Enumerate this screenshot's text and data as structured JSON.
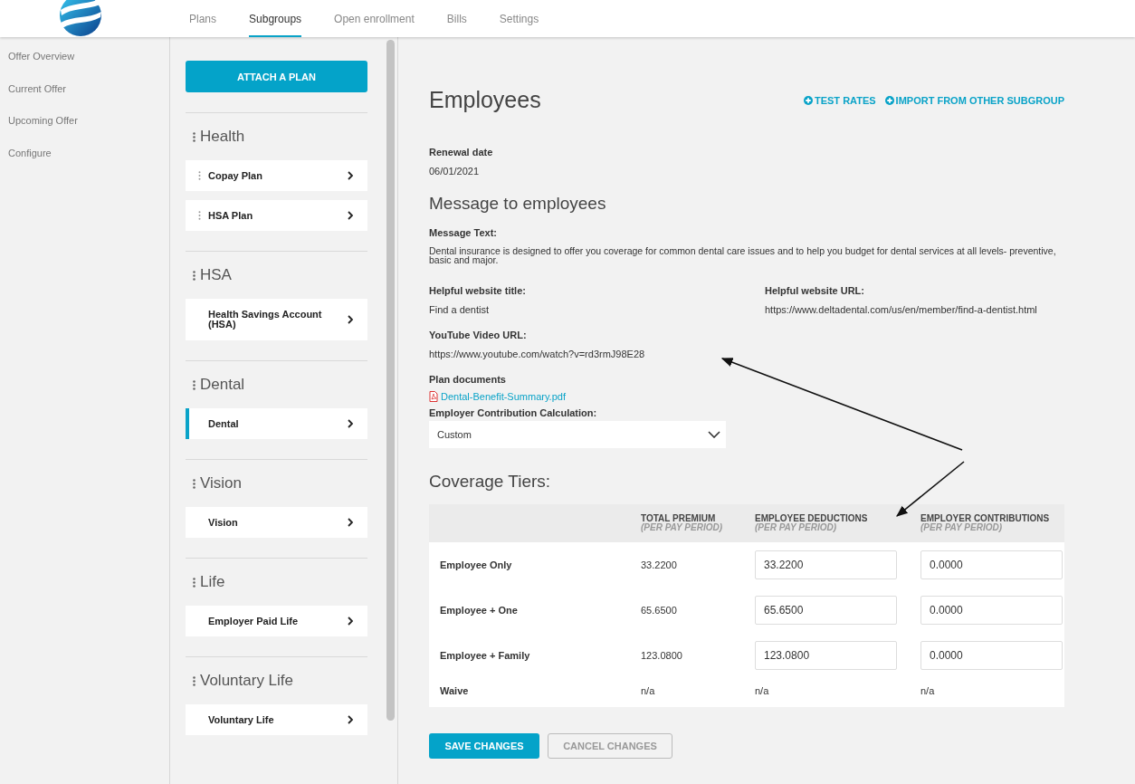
{
  "nav": {
    "tabs": [
      {
        "label": "Plans",
        "selected": false
      },
      {
        "label": "Subgroups",
        "selected": true
      },
      {
        "label": "Open enrollment",
        "selected": false
      },
      {
        "label": "Bills",
        "selected": false
      },
      {
        "label": "Settings",
        "selected": false
      }
    ]
  },
  "sidebar": {
    "items": [
      "Offer Overview",
      "Current Offer",
      "Upcoming Offer",
      "Configure"
    ]
  },
  "plan_panel": {
    "attach_button": "ATTACH A PLAN",
    "groups": [
      {
        "title": "Health",
        "items": [
          {
            "label": "Copay Plan",
            "selected": false,
            "draggable": true
          },
          {
            "label": "HSA Plan",
            "selected": false,
            "draggable": true
          }
        ]
      },
      {
        "title": "HSA",
        "items": [
          {
            "label": "Health Savings Account (HSA)",
            "selected": false,
            "draggable": false
          }
        ]
      },
      {
        "title": "Dental",
        "items": [
          {
            "label": "Dental",
            "selected": true,
            "draggable": false
          }
        ]
      },
      {
        "title": "Vision",
        "items": [
          {
            "label": "Vision",
            "selected": false,
            "draggable": false
          }
        ]
      },
      {
        "title": "Life",
        "items": [
          {
            "label": "Employer Paid Life",
            "selected": false,
            "draggable": false
          }
        ]
      },
      {
        "title": "Voluntary Life",
        "items": [
          {
            "label": "Voluntary Life",
            "selected": false,
            "draggable": false
          }
        ]
      }
    ]
  },
  "main": {
    "title": "Employees",
    "actions": [
      "TEST RATES",
      "IMPORT FROM OTHER SUBGROUP"
    ],
    "renewal": {
      "label": "Renewal date",
      "value": "06/01/2021"
    },
    "message_heading": "Message to employees",
    "message": {
      "label": "Message Text:",
      "value": "Dental insurance is designed to offer you coverage for common dental care issues and to help you budget for dental services at all levels- preventive, basic and major."
    },
    "website_title": {
      "label": "Helpful website title:",
      "value": "Find a dentist"
    },
    "website_url": {
      "label": "Helpful website URL:",
      "value": "https://www.deltadental.com/us/en/member/find-a-dentist.html"
    },
    "youtube": {
      "label": "YouTube Video URL:",
      "value": "https://www.youtube.com/watch?v=rd3rmJ98E28"
    },
    "plan_documents": {
      "label": "Plan documents",
      "files": [
        "Dental-Benefit-Summary.pdf"
      ]
    },
    "contribution": {
      "label": "Employer Contribution Calculation:",
      "value": "Custom"
    },
    "tiers_heading": "Coverage Tiers:",
    "table": {
      "columns": [
        {
          "title": "TOTAL PREMIUM",
          "subtitle": "(PER PAY PERIOD)"
        },
        {
          "title": "EMPLOYEE DEDUCTIONS",
          "subtitle": "(PER PAY PERIOD)"
        },
        {
          "title": "EMPLOYER CONTRIBUTIONS",
          "subtitle": "(PER PAY PERIOD)"
        }
      ],
      "rows": [
        {
          "kind": "input",
          "tier": "Employee Only",
          "total": "33.2200",
          "deduction": "33.2200",
          "contribution": "0.0000"
        },
        {
          "kind": "input",
          "tier": "Employee + One",
          "total": "65.6500",
          "deduction": "65.6500",
          "contribution": "0.0000"
        },
        {
          "kind": "input",
          "tier": "Employee + Family",
          "total": "123.0800",
          "deduction": "123.0800",
          "contribution": "0.0000"
        },
        {
          "kind": "text",
          "tier": "Waive",
          "total": "n/a",
          "deduction": "n/a",
          "contribution": "n/a"
        }
      ]
    },
    "buttons": [
      {
        "label": "SAVE CHANGES",
        "kind": "primary"
      },
      {
        "label": "CANCEL CHANGES",
        "kind": "secondary"
      }
    ]
  }
}
